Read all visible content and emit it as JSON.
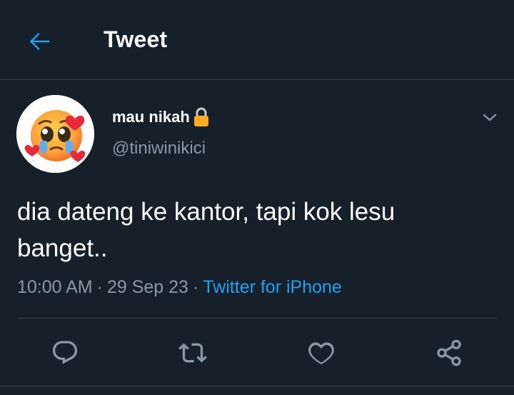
{
  "header": {
    "title": "Tweet",
    "back_icon": "arrow-left-icon"
  },
  "tweet": {
    "author": {
      "display_name": "mau nikah",
      "handle": "@tiniwinikici",
      "avatar": "pleading-face-with-hearts-emoji",
      "protected_icon": "lock-icon"
    },
    "text": "dia dateng ke kantor, tapi kok lesu banget..",
    "time": "10:00 AM",
    "date": "29 Sep 23",
    "separator": "·",
    "source": "Twitter for iPhone",
    "menu_icon": "chevron-down-icon"
  },
  "actions": [
    {
      "name": "reply",
      "icon": "reply-icon"
    },
    {
      "name": "retweet",
      "icon": "retweet-icon"
    },
    {
      "name": "like",
      "icon": "heart-icon"
    },
    {
      "name": "share",
      "icon": "share-icon"
    }
  ],
  "colors": {
    "background": "#15202b",
    "accent": "#1da1f2",
    "secondary_text": "#8899a6",
    "divider": "#38444d",
    "lock": "#ffad1f"
  }
}
